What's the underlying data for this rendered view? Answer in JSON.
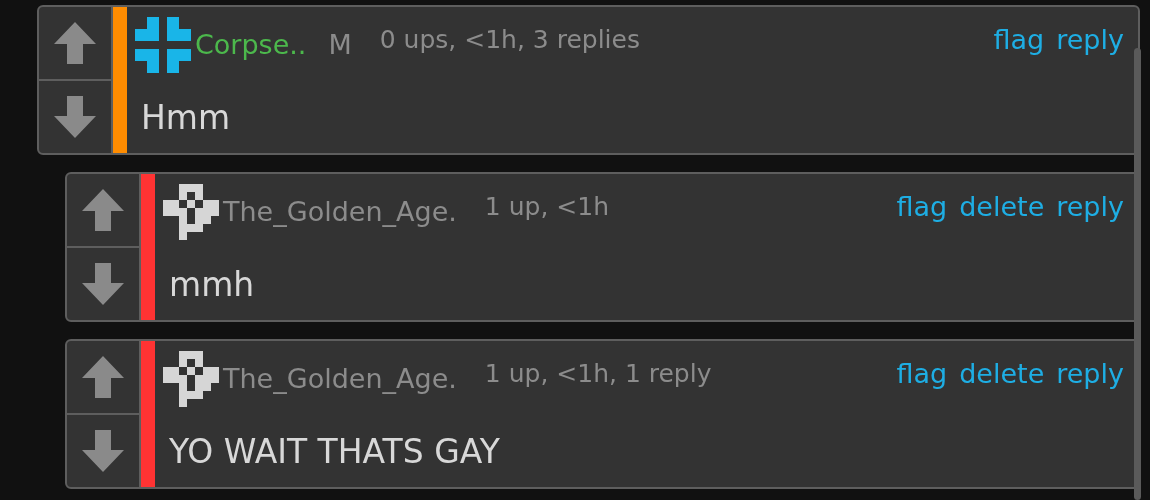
{
  "comments": [
    {
      "avatar": {
        "kind": "cross"
      },
      "username": {
        "text": "Corpse..",
        "color": "#4cb84c"
      },
      "badge": "M",
      "meta": "0 ups, <1h, 3 replies",
      "actions": [
        "flag",
        "reply"
      ],
      "text": "Hmm",
      "color": "#ff8c00",
      "children": [
        {
          "avatar": {
            "kind": "pixel"
          },
          "username": {
            "text": "The_Golden_Age.",
            "color": "#8c8c8c"
          },
          "meta": "1 up, <1h",
          "actions": [
            "flag",
            "delete",
            "reply"
          ],
          "text": "mmh",
          "color": "#ff3333"
        },
        {
          "avatar": {
            "kind": "pixel"
          },
          "username": {
            "text": "The_Golden_Age.",
            "color": "#8c8c8c"
          },
          "meta": "1 up, <1h, 1 reply",
          "actions": [
            "flag",
            "delete",
            "reply"
          ],
          "text": "YO WAIT THATS GAY",
          "color": "#ff3333"
        }
      ]
    }
  ]
}
